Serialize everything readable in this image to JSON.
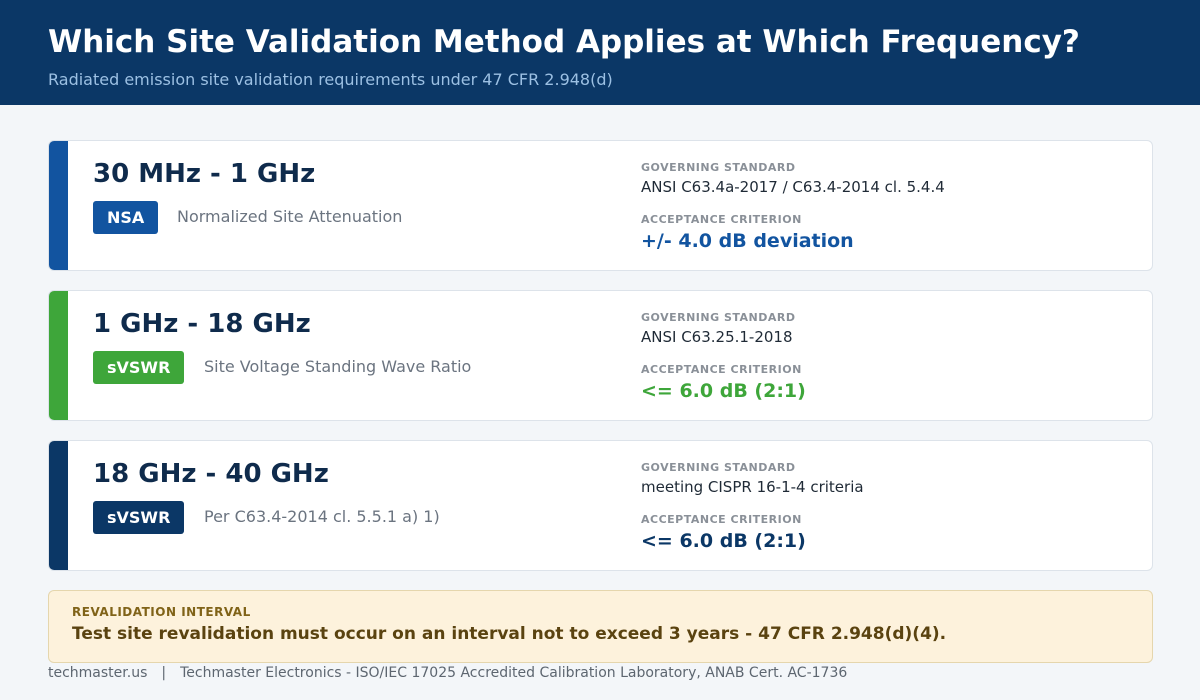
{
  "header": {
    "title": "Which Site Validation Method Applies at Which Frequency?",
    "subtitle": "Radiated emission site validation requirements under 47 CFR 2.948(d)"
  },
  "cards": [
    {
      "range": "30 MHz - 1 GHz",
      "badge": "NSA",
      "method": "Normalized Site Attenuation",
      "standard_label": "GOVERNING STANDARD",
      "standard": "ANSI C63.4a-2017 / C63.4-2014 cl. 5.4.4",
      "criterion_label": "ACCEPTANCE CRITERION",
      "criterion": "+/- 4.0 dB deviation",
      "color": "#1254a0"
    },
    {
      "range": "1 GHz - 18 GHz",
      "badge": "sVSWR",
      "method": "Site Voltage Standing Wave Ratio",
      "standard_label": "GOVERNING STANDARD",
      "standard": "ANSI C63.25.1-2018",
      "criterion_label": "ACCEPTANCE CRITERION",
      "criterion": "<= 6.0 dB  (2:1)",
      "color": "#3ea63a"
    },
    {
      "range": "18 GHz - 40 GHz",
      "badge": "sVSWR",
      "method": "Per C63.4-2014 cl. 5.5.1 a) 1)",
      "standard_label": "GOVERNING STANDARD",
      "standard": "meeting CISPR 16-1-4 criteria",
      "criterion_label": "ACCEPTANCE CRITERION",
      "criterion": "<= 6.0 dB  (2:1)",
      "color": "#0b3766"
    }
  ],
  "notice": {
    "label": "REVALIDATION INTERVAL",
    "text": "Test site revalidation must occur on an interval not to exceed 3 years - 47 CFR 2.948(d)(4)."
  },
  "footer": {
    "site": "techmaster.us",
    "separator": "|",
    "org": "Techmaster Electronics - ISO/IEC 17025 Accredited Calibration Laboratory, ANAB Cert. AC-1736"
  }
}
